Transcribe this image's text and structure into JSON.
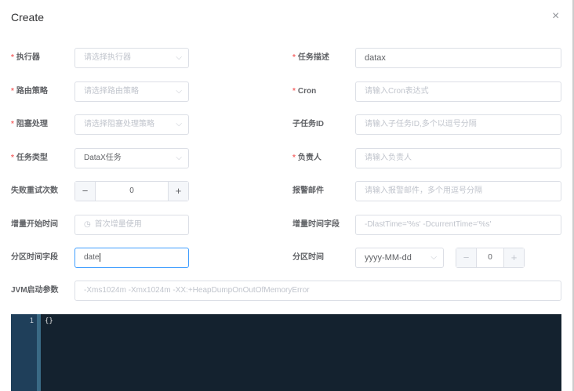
{
  "dialog": {
    "title": "Create",
    "close": "×"
  },
  "left": [
    {
      "label": "执行器",
      "required": true,
      "type": "select",
      "placeholder": "请选择执行器"
    },
    {
      "label": "路由策略",
      "required": true,
      "type": "select",
      "placeholder": "请选择路由策略"
    },
    {
      "label": "阻塞处理",
      "required": true,
      "type": "select",
      "placeholder": "请选择阻塞处理策略"
    },
    {
      "label": "任务类型",
      "required": true,
      "type": "select",
      "value": "DataX任务"
    },
    {
      "label": "失败重试次数",
      "required": false,
      "type": "number",
      "value": "0"
    },
    {
      "label": "增量开始时间",
      "required": false,
      "type": "date",
      "placeholder": "首次增量使用"
    },
    {
      "label": "分区时间字段",
      "required": false,
      "type": "input",
      "value": "date"
    }
  ],
  "right": [
    {
      "label": "任务描述",
      "required": true,
      "value": "datax"
    },
    {
      "label": "Cron",
      "required": true,
      "placeholder": "请输入Cron表达式"
    },
    {
      "label": "子任务ID",
      "required": false,
      "placeholder": "请输入子任务ID,多个以逗号分隔"
    },
    {
      "label": "负责人",
      "required": true,
      "placeholder": "请输入负责人"
    },
    {
      "label": "报警邮件",
      "required": false,
      "placeholder": "请输入报警邮件，多个用逗号分隔"
    },
    {
      "label": "增量时间字段",
      "required": false,
      "placeholder": "-DlastTime='%s' -DcurrentTime='%s'"
    },
    {
      "label": "分区时间",
      "required": false,
      "format": "yyyy-MM-dd",
      "offset": "0"
    }
  ],
  "jvm": {
    "label": "JVM启动参数",
    "placeholder": "-Xms1024m -Xmx1024m -XX:+HeapDumpOnOutOfMemoryError"
  },
  "editor": {
    "line": "1",
    "code": "{}"
  },
  "symbols": {
    "required": "*",
    "chevron": "⌵",
    "minus": "−",
    "plus": "+",
    "clock": "◷"
  }
}
